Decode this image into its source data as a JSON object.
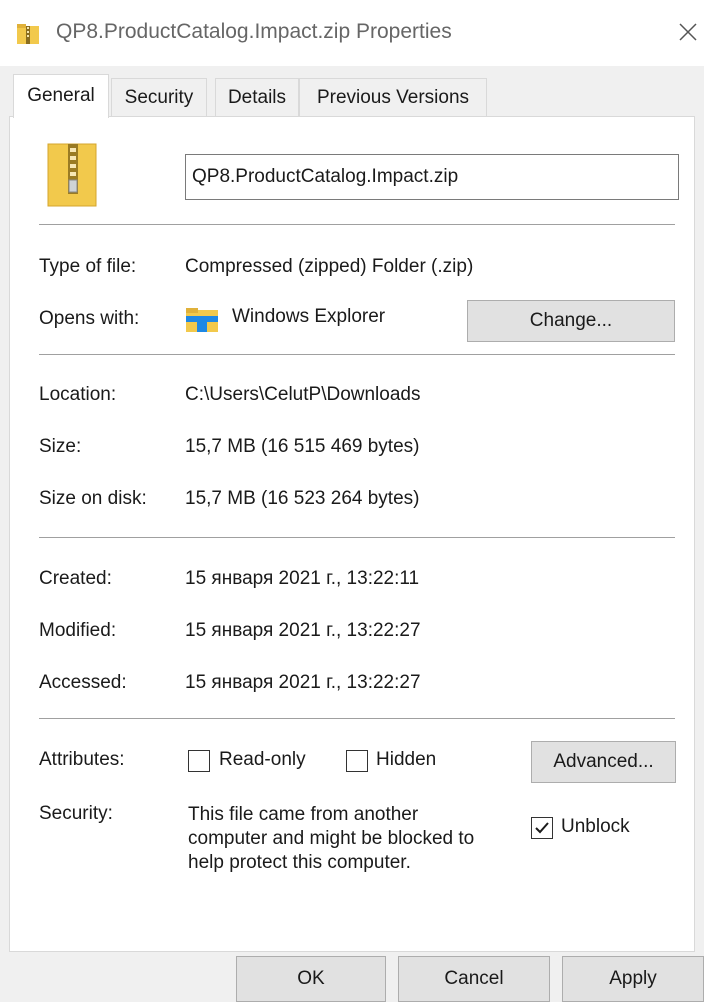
{
  "window": {
    "title": "QP8.ProductCatalog.Impact.zip Properties",
    "icon": "zip-folder-icon",
    "close_icon": "close-icon"
  },
  "tabs": [
    {
      "label": "General",
      "active": true
    },
    {
      "label": "Security",
      "active": false
    },
    {
      "label": "Details",
      "active": false
    },
    {
      "label": "Previous Versions",
      "active": false
    }
  ],
  "general": {
    "file_icon": "zip-folder-icon",
    "file_name": "QP8.ProductCatalog.Impact.zip",
    "type_label": "Type of file:",
    "type_value": "Compressed (zipped) Folder (.zip)",
    "opens_label": "Opens with:",
    "opens_icon": "explorer-folder-icon",
    "opens_value": "Windows Explorer",
    "change_button": "Change...",
    "location_label": "Location:",
    "location_value": "C:\\Users\\CelutP\\Downloads",
    "size_label": "Size:",
    "size_value": "15,7 MB (16 515 469 bytes)",
    "size_disk_label": "Size on disk:",
    "size_disk_value": "15,7 MB (16 523 264 bytes)",
    "created_label": "Created:",
    "created_value": "15 января 2021 г., 13:22:11",
    "modified_label": "Modified:",
    "modified_value": "15 января 2021 г., 13:22:27",
    "accessed_label": "Accessed:",
    "accessed_value": "15 января 2021 г., 13:22:27",
    "attributes_label": "Attributes:",
    "readonly_label": "Read-only",
    "readonly_checked": false,
    "hidden_label": "Hidden",
    "hidden_checked": false,
    "advanced_button": "Advanced...",
    "security_label": "Security:",
    "security_line1": "This file came from another",
    "security_line2": "computer and might be blocked to",
    "security_line3": "help protect this computer.",
    "unblock_label": "Unblock",
    "unblock_checked": true
  },
  "footer": {
    "ok": "OK",
    "cancel": "Cancel",
    "apply": "Apply"
  },
  "colors": {
    "dialog_bg": "#f0f0f0",
    "panel_bg": "#ffffff",
    "button_bg": "#e1e1e1",
    "folder_yellow": "#f2c94c",
    "explorer_blue": "#1e88e5"
  }
}
